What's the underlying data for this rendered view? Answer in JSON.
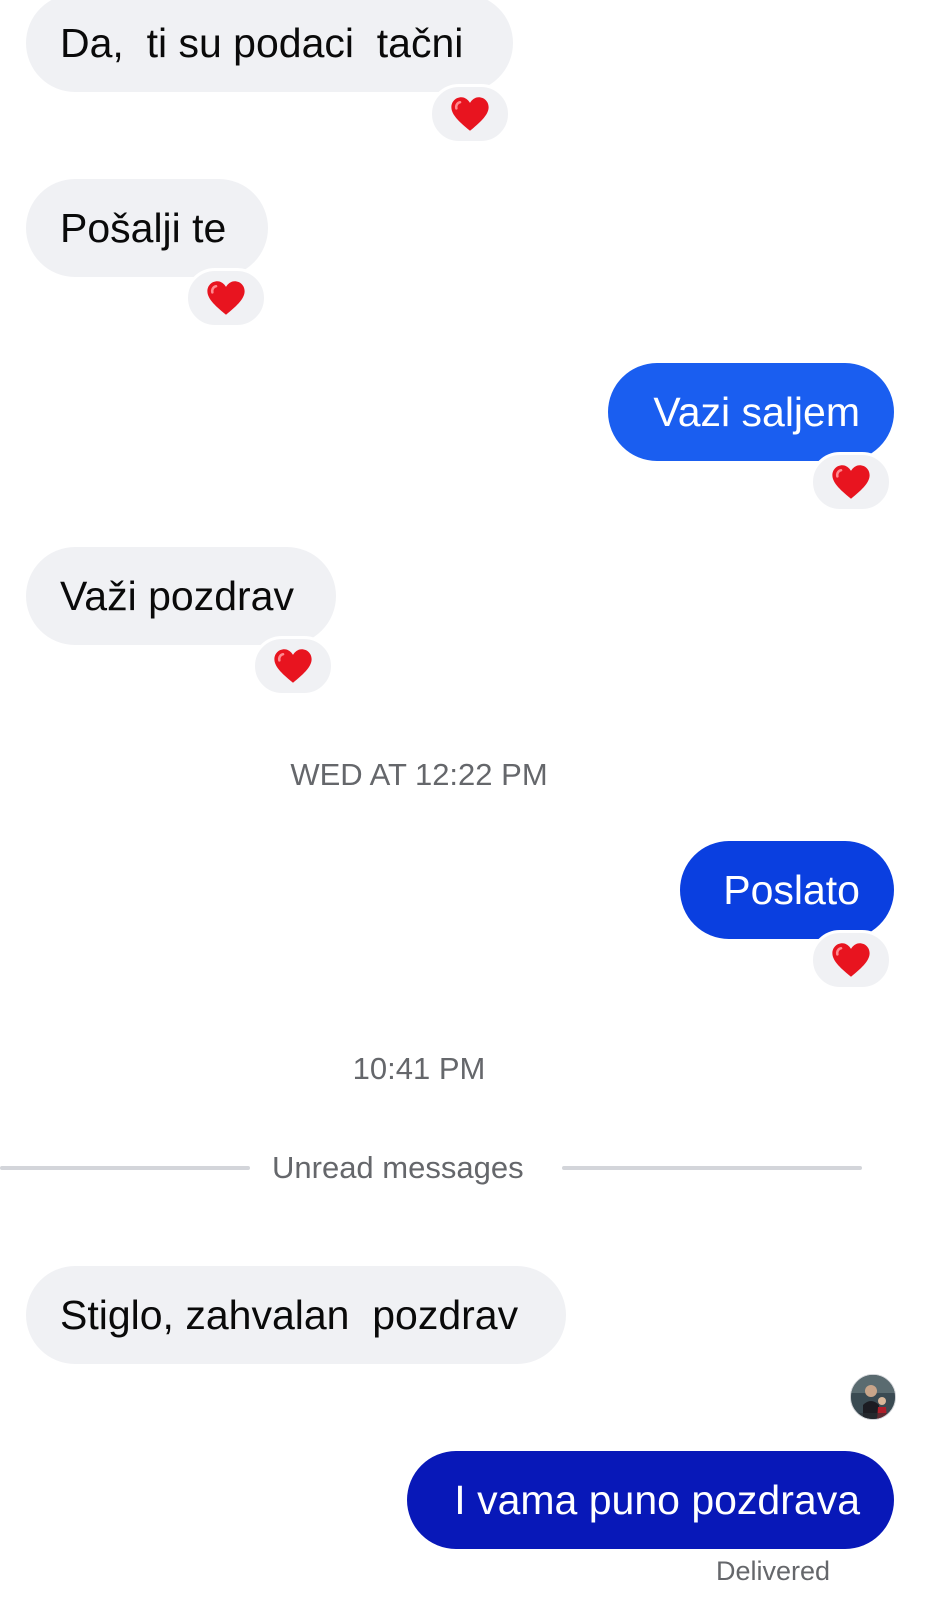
{
  "messages": [
    {
      "text": "Da,  ti su podaci  tačni",
      "direction": "incoming",
      "reaction": "heart"
    },
    {
      "text": "Pošalji te",
      "direction": "incoming",
      "reaction": "heart"
    },
    {
      "text": "Vazi saljem",
      "direction": "outgoing",
      "reaction": "heart"
    },
    {
      "text": "Važi pozdrav",
      "direction": "incoming",
      "reaction": "heart"
    },
    {
      "text": "Poslato",
      "direction": "outgoing",
      "reaction": "heart"
    },
    {
      "text": "Stiglo, zahvalan  pozdrav",
      "direction": "incoming"
    },
    {
      "text": "I vama puno pozdrava",
      "direction": "outgoing"
    }
  ],
  "timestamps": [
    "WED AT 12:22 PM",
    "10:41 PM"
  ],
  "unread_divider": {
    "label": "Unread messages"
  },
  "seen_avatar": {
    "icon": "profile-photo-avatar"
  },
  "status": {
    "label": "Delivered"
  },
  "colors": {
    "incoming_bubble": "#f0f1f4",
    "outgoing_gradient_top": "#1a5ef0",
    "outgoing_gradient_mid": "#0a3fe0",
    "outgoing_gradient_bottom": "#0818b8",
    "reaction_heart": "#e8141f",
    "muted_text": "#65676b"
  }
}
